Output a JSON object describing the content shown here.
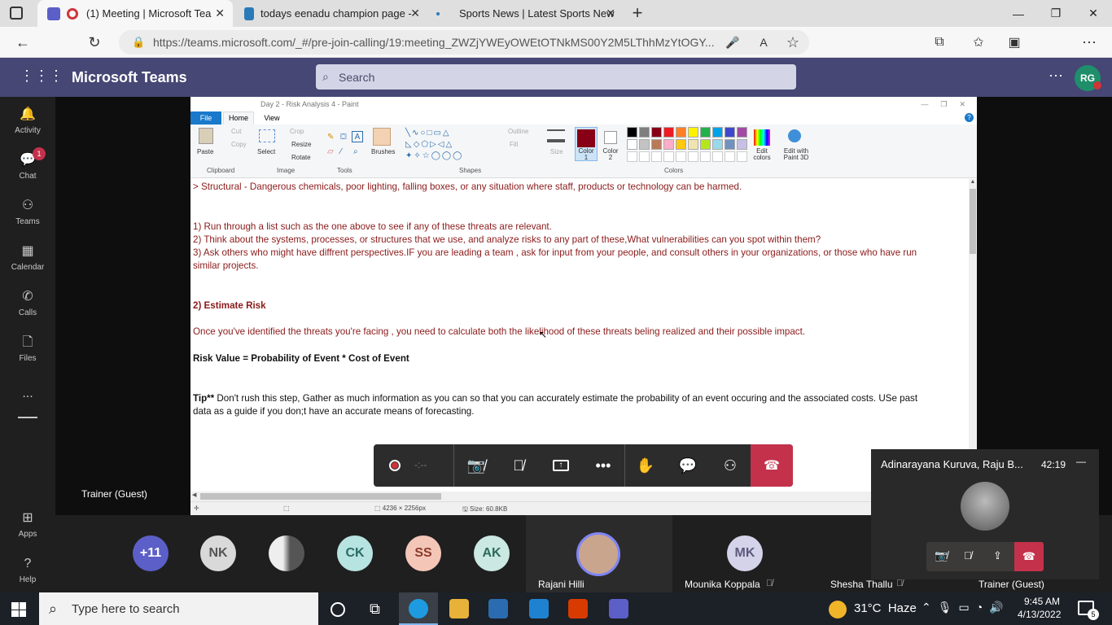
{
  "browser": {
    "tabs": [
      {
        "title": "(1) Meeting | Microsoft Tea",
        "active": true
      },
      {
        "title": "todays eenadu champion page -",
        "active": false
      },
      {
        "title": "Sports News | Latest Sports New",
        "active": false
      }
    ],
    "url": "https://teams.microsoft.com/_#/pre-join-calling/19:meeting_ZWZjYWEyOWEtOTNkMS00Y2M5LThhMzYtOGY..."
  },
  "teams": {
    "app_title": "Microsoft Teams",
    "search_placeholder": "Search",
    "user_initials": "RG",
    "rail": [
      {
        "label": "Activity",
        "icon": "bell-icon"
      },
      {
        "label": "Chat",
        "icon": "chat-icon",
        "badge": "1"
      },
      {
        "label": "Teams",
        "icon": "teams-icon"
      },
      {
        "label": "Calendar",
        "icon": "calendar-icon"
      },
      {
        "label": "Calls",
        "icon": "phone-icon"
      },
      {
        "label": "Files",
        "icon": "file-icon"
      },
      {
        "label": "...",
        "icon": "more-icon"
      }
    ],
    "rail_bottom": [
      {
        "label": "Apps",
        "icon": "apps-icon"
      },
      {
        "label": "Help",
        "icon": "help-icon"
      }
    ],
    "presenter_label": "Trainer (Guest)"
  },
  "paint": {
    "title": "Day 2 - Risk Analysis 4 - Paint",
    "tabs": [
      "File",
      "Home",
      "View"
    ],
    "groups": [
      "Clipboard",
      "Image",
      "Tools",
      "Shapes",
      "Colors"
    ],
    "clipboard": {
      "paste": "Paste",
      "cut": "Cut",
      "copy": "Copy"
    },
    "image": {
      "select": "Select",
      "crop": "Crop",
      "resize": "Resize",
      "rotate": "Rotate"
    },
    "brushes": "Brushes",
    "outline": "Outline",
    "fill": "Fill",
    "size": "Size",
    "color1": "Color 1",
    "color2": "Color 2",
    "edit_colors": "Edit colors",
    "edit_paint3d": "Edit with Paint 3D",
    "status_dims": "4236 × 2256px",
    "status_size": "Size: 60.8KB",
    "lines": [
      "> Structural - Dangerous chemicals, poor lighting, falling boxes, or any situation where staff, products or technology can be harmed.",
      "1) Run through a list such as the one above to see if any of these threats are relevant.",
      "2) Think about the systems, processes, or structures that we use, and analyze risks to any part of these,What vulnerabilities can you spot within them?",
      "3) Ask others who might have diffrent perspectives.IF you are leading a team , ask for input from your people, and consult others in your organizations, or those who have run",
      "similar projects.",
      "2) Estimate Risk",
      "Once you've identified the threats you're facing , you need to calculate both the likelihood of these threats beling realized and their possible impact.",
      "Risk Value = Probability of Event * Cost of Event",
      "Tip**",
      " Don't rush this step, Gather as much information as you can so that you can accurately estimate the probability of an event occuring and the associated costs. USe past",
      "data as a guide if you don;t have an accurate means of forecasting."
    ],
    "palette": [
      "#000000",
      "#7f7f7f",
      "#880015",
      "#ed1c24",
      "#ff7f27",
      "#fff200",
      "#22b14c",
      "#00a2e8",
      "#3f48cc",
      "#a349a4",
      "#ffffff",
      "#c3c3c3",
      "#b97a57",
      "#ffaec9",
      "#ffc90e",
      "#efe4b0",
      "#b5e61d",
      "#99d9ea",
      "#7092be",
      "#c8bfe7"
    ]
  },
  "call": {
    "timer_placeholder": "-:--",
    "mini_title": "Adinarayana Kuruva, Raju B...",
    "mini_timer": "42:19",
    "participants": [
      {
        "label": "+11",
        "color": "#5b5fc7"
      },
      {
        "label": "NK",
        "color": "#d9d9d9"
      },
      {
        "label": "",
        "color": "#bdbdbd"
      },
      {
        "label": "CK",
        "color": "#b7e3e0"
      },
      {
        "label": "SS",
        "color": "#f4c6b8"
      },
      {
        "label": "AK",
        "color": "#cbe8e2"
      }
    ],
    "named": [
      {
        "name": "Rajani Hilli"
      },
      {
        "name": "Mounika Koppala",
        "initials": "MK"
      },
      {
        "name": "Shesha Thallu"
      },
      {
        "name": "Trainer (Guest)"
      }
    ]
  },
  "taskbar": {
    "search_placeholder": "Type here to search",
    "weather": "31°C  Haze",
    "time": "9:45 AM",
    "date": "4/13/2022",
    "notif_count": "5"
  }
}
